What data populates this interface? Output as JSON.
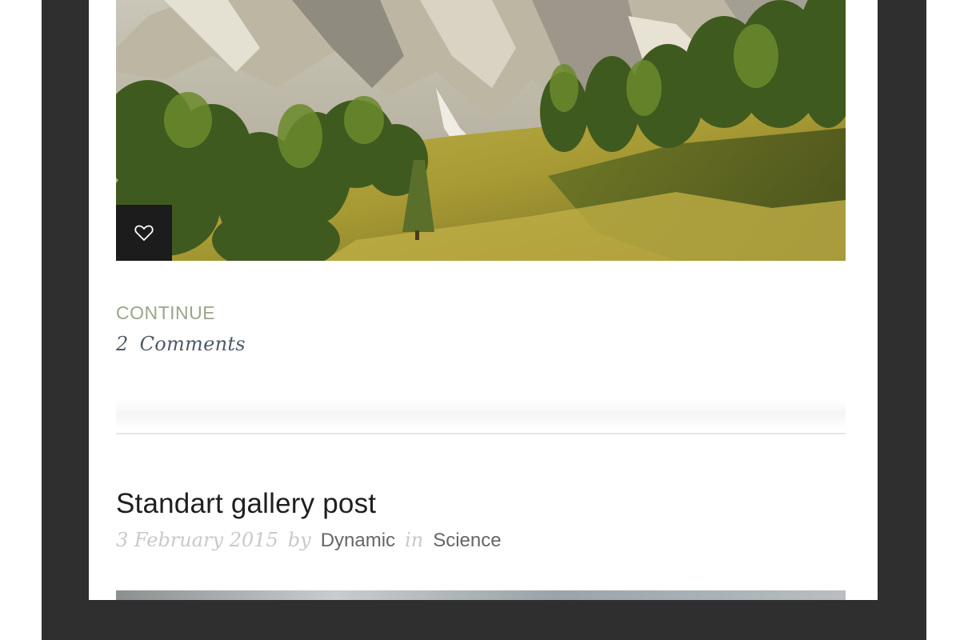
{
  "post_prev": {
    "continue_label": "CONTINUE",
    "comments_count": "2",
    "comments_label": "Comments"
  },
  "post_next": {
    "title": "Standart gallery post",
    "date": "3 February 2015",
    "by_label": "by",
    "author": "Dynamic",
    "in_label": "in",
    "category": "Science"
  },
  "icons": {
    "like": "heart-icon"
  },
  "colors": {
    "device_frame": "#2f2f2f",
    "continue_link": "#9aa58a",
    "comments_text": "#4e5a66",
    "meta_muted": "#c9c9c9",
    "meta_link": "#666666"
  }
}
